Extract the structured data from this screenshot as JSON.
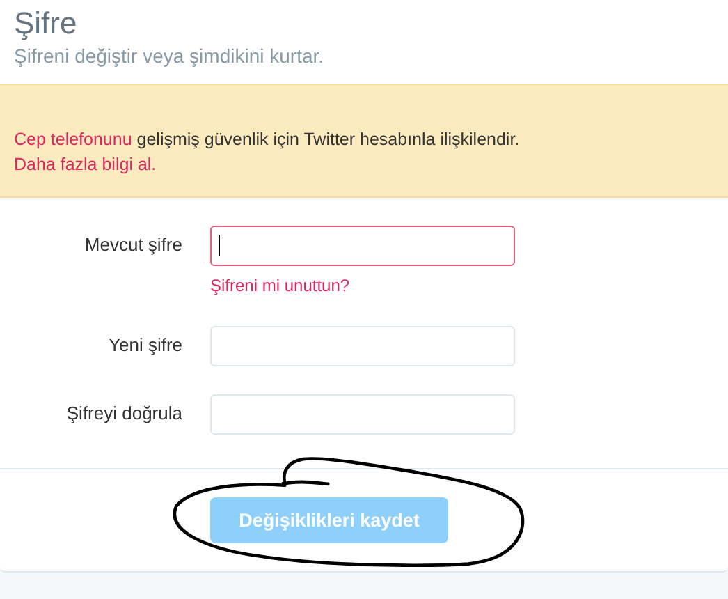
{
  "header": {
    "title": "Şifre",
    "subtitle": "Şifreni değiştir veya şimdikini kurtar."
  },
  "banner": {
    "link": "Cep telefonunu",
    "text": "gelişmiş güvenlik için Twitter hesabınla ilişkilendir.",
    "more_link": "Daha fazla bilgi al."
  },
  "fields": [
    {
      "label": "Mevcut şifre",
      "focused": true,
      "help_link": "Şifreni mi unuttun?"
    },
    {
      "label": "Yeni şifre",
      "focused": false
    },
    {
      "label": "Şifreyi doğrula",
      "focused": false
    }
  ],
  "save_button": {
    "label": "Değişiklikleri kaydet",
    "disabled": true
  }
}
